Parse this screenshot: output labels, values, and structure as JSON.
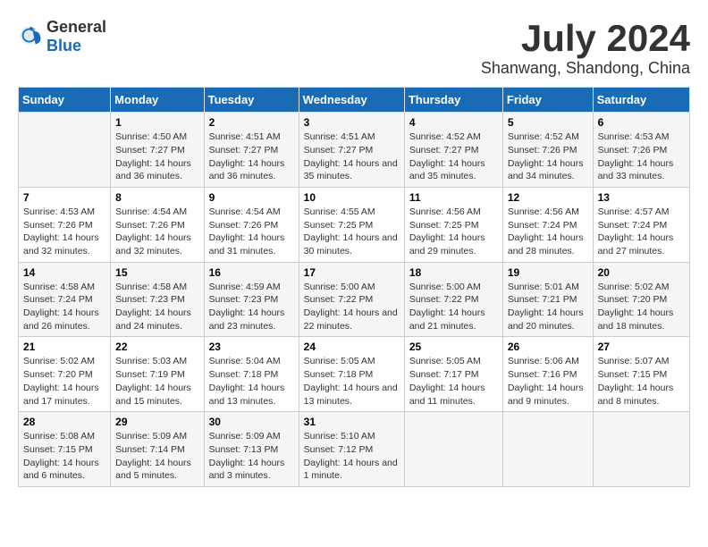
{
  "header": {
    "logo_general": "General",
    "logo_blue": "Blue",
    "month": "July 2024",
    "location": "Shanwang, Shandong, China"
  },
  "days_of_week": [
    "Sunday",
    "Monday",
    "Tuesday",
    "Wednesday",
    "Thursday",
    "Friday",
    "Saturday"
  ],
  "weeks": [
    [
      {
        "day": "",
        "sunrise": "",
        "sunset": "",
        "daylight": ""
      },
      {
        "day": "1",
        "sunrise": "4:50 AM",
        "sunset": "7:27 PM",
        "daylight": "14 hours and 36 minutes."
      },
      {
        "day": "2",
        "sunrise": "4:51 AM",
        "sunset": "7:27 PM",
        "daylight": "14 hours and 36 minutes."
      },
      {
        "day": "3",
        "sunrise": "4:51 AM",
        "sunset": "7:27 PM",
        "daylight": "14 hours and 35 minutes."
      },
      {
        "day": "4",
        "sunrise": "4:52 AM",
        "sunset": "7:27 PM",
        "daylight": "14 hours and 35 minutes."
      },
      {
        "day": "5",
        "sunrise": "4:52 AM",
        "sunset": "7:26 PM",
        "daylight": "14 hours and 34 minutes."
      },
      {
        "day": "6",
        "sunrise": "4:53 AM",
        "sunset": "7:26 PM",
        "daylight": "14 hours and 33 minutes."
      }
    ],
    [
      {
        "day": "7",
        "sunrise": "4:53 AM",
        "sunset": "7:26 PM",
        "daylight": "14 hours and 32 minutes."
      },
      {
        "day": "8",
        "sunrise": "4:54 AM",
        "sunset": "7:26 PM",
        "daylight": "14 hours and 32 minutes."
      },
      {
        "day": "9",
        "sunrise": "4:54 AM",
        "sunset": "7:26 PM",
        "daylight": "14 hours and 31 minutes."
      },
      {
        "day": "10",
        "sunrise": "4:55 AM",
        "sunset": "7:25 PM",
        "daylight": "14 hours and 30 minutes."
      },
      {
        "day": "11",
        "sunrise": "4:56 AM",
        "sunset": "7:25 PM",
        "daylight": "14 hours and 29 minutes."
      },
      {
        "day": "12",
        "sunrise": "4:56 AM",
        "sunset": "7:24 PM",
        "daylight": "14 hours and 28 minutes."
      },
      {
        "day": "13",
        "sunrise": "4:57 AM",
        "sunset": "7:24 PM",
        "daylight": "14 hours and 27 minutes."
      }
    ],
    [
      {
        "day": "14",
        "sunrise": "4:58 AM",
        "sunset": "7:24 PM",
        "daylight": "14 hours and 26 minutes."
      },
      {
        "day": "15",
        "sunrise": "4:58 AM",
        "sunset": "7:23 PM",
        "daylight": "14 hours and 24 minutes."
      },
      {
        "day": "16",
        "sunrise": "4:59 AM",
        "sunset": "7:23 PM",
        "daylight": "14 hours and 23 minutes."
      },
      {
        "day": "17",
        "sunrise": "5:00 AM",
        "sunset": "7:22 PM",
        "daylight": "14 hours and 22 minutes."
      },
      {
        "day": "18",
        "sunrise": "5:00 AM",
        "sunset": "7:22 PM",
        "daylight": "14 hours and 21 minutes."
      },
      {
        "day": "19",
        "sunrise": "5:01 AM",
        "sunset": "7:21 PM",
        "daylight": "14 hours and 20 minutes."
      },
      {
        "day": "20",
        "sunrise": "5:02 AM",
        "sunset": "7:20 PM",
        "daylight": "14 hours and 18 minutes."
      }
    ],
    [
      {
        "day": "21",
        "sunrise": "5:02 AM",
        "sunset": "7:20 PM",
        "daylight": "14 hours and 17 minutes."
      },
      {
        "day": "22",
        "sunrise": "5:03 AM",
        "sunset": "7:19 PM",
        "daylight": "14 hours and 15 minutes."
      },
      {
        "day": "23",
        "sunrise": "5:04 AM",
        "sunset": "7:18 PM",
        "daylight": "14 hours and 13 minutes."
      },
      {
        "day": "24",
        "sunrise": "5:05 AM",
        "sunset": "7:18 PM",
        "daylight": "14 hours and 13 minutes."
      },
      {
        "day": "25",
        "sunrise": "5:05 AM",
        "sunset": "7:17 PM",
        "daylight": "14 hours and 11 minutes."
      },
      {
        "day": "26",
        "sunrise": "5:06 AM",
        "sunset": "7:16 PM",
        "daylight": "14 hours and 9 minutes."
      },
      {
        "day": "27",
        "sunrise": "5:07 AM",
        "sunset": "7:15 PM",
        "daylight": "14 hours and 8 minutes."
      }
    ],
    [
      {
        "day": "28",
        "sunrise": "5:08 AM",
        "sunset": "7:15 PM",
        "daylight": "14 hours and 6 minutes."
      },
      {
        "day": "29",
        "sunrise": "5:09 AM",
        "sunset": "7:14 PM",
        "daylight": "14 hours and 5 minutes."
      },
      {
        "day": "30",
        "sunrise": "5:09 AM",
        "sunset": "7:13 PM",
        "daylight": "14 hours and 3 minutes."
      },
      {
        "day": "31",
        "sunrise": "5:10 AM",
        "sunset": "7:12 PM",
        "daylight": "14 hours and 1 minute."
      },
      {
        "day": "",
        "sunrise": "",
        "sunset": "",
        "daylight": ""
      },
      {
        "day": "",
        "sunrise": "",
        "sunset": "",
        "daylight": ""
      },
      {
        "day": "",
        "sunrise": "",
        "sunset": "",
        "daylight": ""
      }
    ]
  ]
}
